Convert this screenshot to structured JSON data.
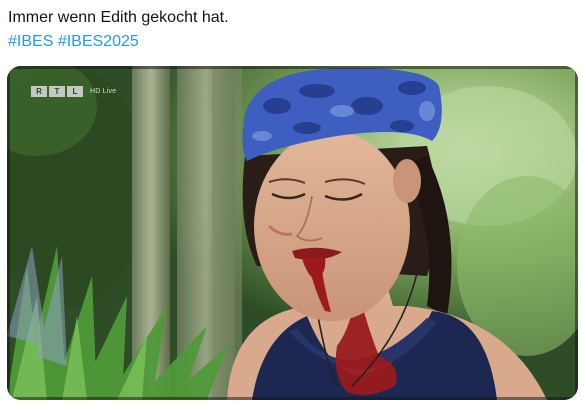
{
  "post": {
    "text": "Immer wenn Edith gekocht hat.",
    "hashtags": [
      "#IBES",
      "#IBES2025"
    ]
  },
  "media": {
    "channel_logo_letters": [
      "R",
      "T",
      "L"
    ],
    "channel_badge": "HD Live"
  },
  "colors": {
    "hashtag": "#1d9bf0",
    "text": "#0f1419",
    "bandana": "#3f5fc0",
    "tank_top": "#1c2852",
    "blood": "#9a1a1e"
  }
}
